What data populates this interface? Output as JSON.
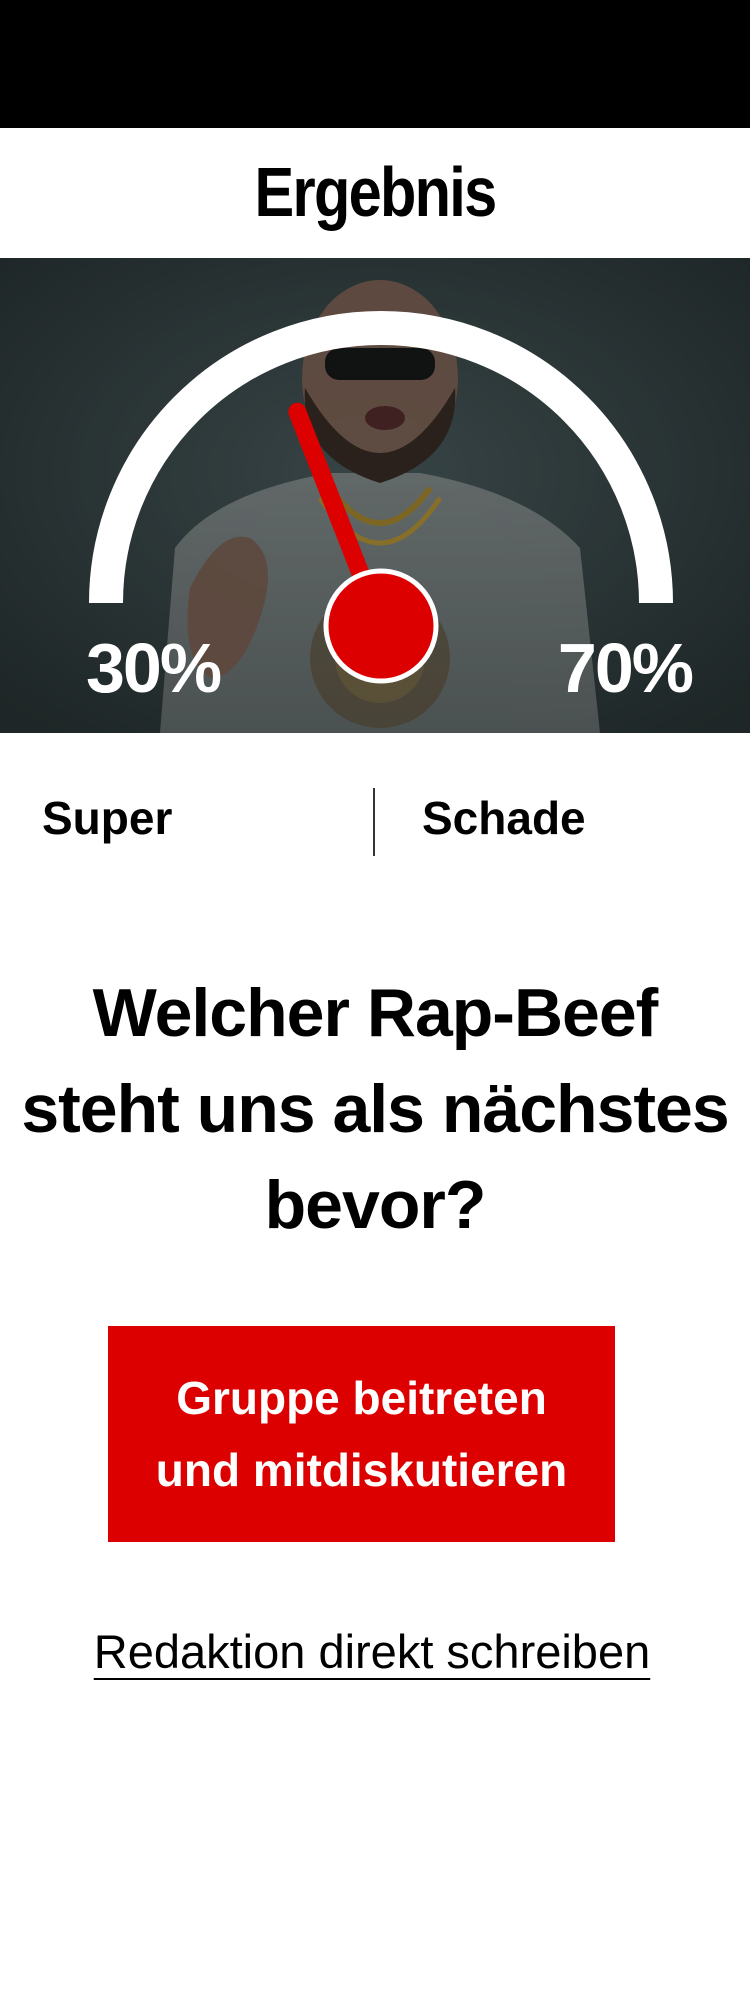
{
  "header": {
    "title": "Ergebnis"
  },
  "poll": {
    "left_percent": "30%",
    "right_percent": "70%",
    "left_label": "Super",
    "right_label": "Schade",
    "needle_fraction_left": 0.3
  },
  "question": {
    "line1": "Welcher Rap-Beef",
    "line2": "steht uns als nächstes",
    "line3": "bevor?"
  },
  "cta": {
    "line1": "Gruppe beitreten",
    "line2": "und mitdiskutieren"
  },
  "contact": {
    "label": "Redaktion direkt schreiben"
  },
  "colors": {
    "accent": "#dd0000",
    "gauge": "#ffffff",
    "background": "#ffffff"
  }
}
